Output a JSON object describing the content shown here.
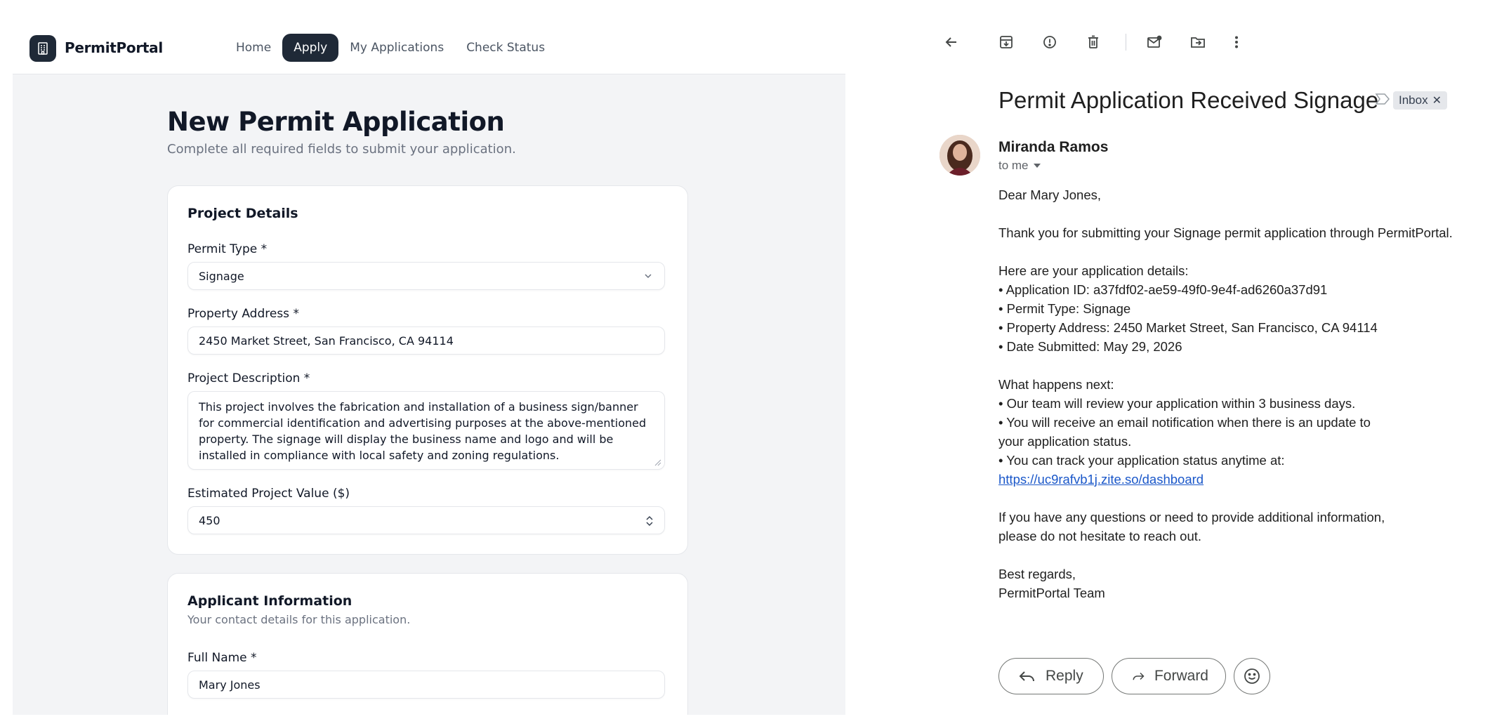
{
  "app": {
    "brand": "PermitPortal",
    "nav": [
      {
        "label": "Home",
        "active": false
      },
      {
        "label": "Apply",
        "active": true
      },
      {
        "label": "My Applications",
        "active": false
      },
      {
        "label": "Check Status",
        "active": false
      }
    ],
    "form": {
      "title": "New Permit Application",
      "subtitle": "Complete all required fields to submit your application.",
      "project_card": {
        "title": "Project Details",
        "permit_type_label": "Permit Type *",
        "permit_type_value": "Signage",
        "address_label": "Property Address *",
        "address_value": "2450 Market Street, San Francisco, CA 94114",
        "description_label": "Project Description *",
        "description_value": "This project involves the fabrication and installation of a business sign/banner for commercial identification and advertising purposes at the above-mentioned property. The signage will display the business name and logo and will be installed in compliance with local safety and zoning regulations.",
        "value_label": "Estimated Project Value ($)",
        "value_value": "450"
      },
      "applicant_card": {
        "title": "Applicant Information",
        "subtitle": "Your contact details for this application.",
        "full_name_label": "Full Name *",
        "full_name_value": "Mary Jones"
      }
    }
  },
  "mail": {
    "subject": "Permit Application Received Signage",
    "label_chip": "Inbox",
    "sender": "Miranda Ramos",
    "recipient": "to me",
    "body": {
      "greeting": "Dear Mary Jones,",
      "intro": "Thank you for submitting your Signage permit application through PermitPortal.",
      "details_heading": "Here are your application details:",
      "details": [
        "• Application ID: a37fdf02-ae59-49f0-9e4f-ad6260a37d91",
        "• Permit Type: Signage",
        "• Property Address: 2450 Market Street, San Francisco, CA 94114",
        "• Date Submitted: May 29, 2026"
      ],
      "next_heading": "What happens next:",
      "next_1": "• Our team will review your application within 3 business days.",
      "next_2a": "• You will receive an email notification when there is an update to",
      "next_2b": "your application status.",
      "next_3": "• You can track your application status anytime at:",
      "link": "https://uc9rafvb1j.zite.so/dashboard",
      "questions_a": "If you have any questions or need to provide additional information,",
      "questions_b": "please do not hesitate to reach out.",
      "closing": "Best regards,",
      "signature": "PermitPortal Team"
    },
    "actions": {
      "reply": "Reply",
      "forward": "Forward"
    }
  }
}
